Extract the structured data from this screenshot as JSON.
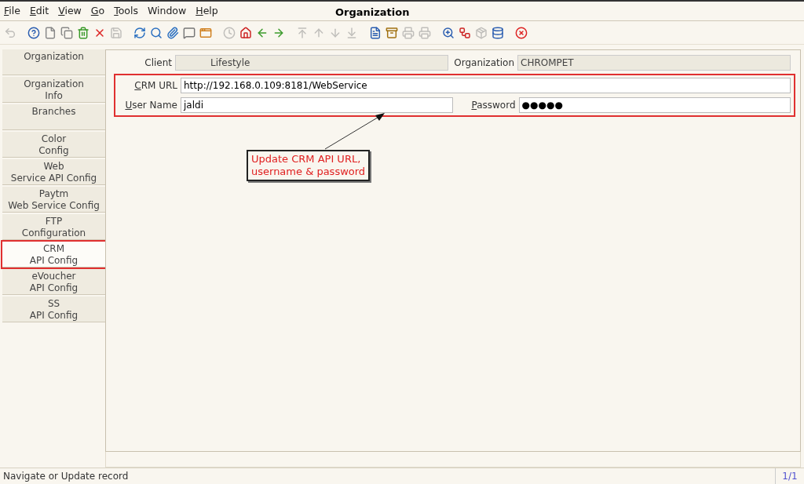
{
  "menu": [
    {
      "label": "File",
      "mnemonic": true
    },
    {
      "label": "Edit",
      "mnemonic": true
    },
    {
      "label": "View",
      "mnemonic": true
    },
    {
      "label": "Go",
      "mnemonic": true
    },
    {
      "label": "Tools",
      "mnemonic": true
    },
    {
      "label": "Window",
      "mnemonic": false
    },
    {
      "label": "Help",
      "mnemonic": true
    }
  ],
  "window": {
    "title": "Organization"
  },
  "toolbar": [
    [
      {
        "kind": "undo",
        "disabled": true
      }
    ],
    [
      {
        "kind": "help",
        "disabled": false
      },
      {
        "kind": "new",
        "disabled": false
      },
      {
        "kind": "copy",
        "disabled": false
      },
      {
        "kind": "delete",
        "disabled": false
      },
      {
        "kind": "delete-selection",
        "disabled": false
      },
      {
        "kind": "save",
        "disabled": true
      }
    ],
    [
      {
        "kind": "refresh",
        "disabled": false
      },
      {
        "kind": "find",
        "disabled": false
      },
      {
        "kind": "attach",
        "disabled": false
      },
      {
        "kind": "chat",
        "disabled": false
      },
      {
        "kind": "form",
        "disabled": false
      }
    ],
    [
      {
        "kind": "history",
        "disabled": true
      },
      {
        "kind": "home",
        "disabled": false
      },
      {
        "kind": "back",
        "disabled": false
      },
      {
        "kind": "forward",
        "disabled": false
      }
    ],
    [
      {
        "kind": "first",
        "disabled": true
      },
      {
        "kind": "previous",
        "disabled": true
      },
      {
        "kind": "next",
        "disabled": true
      },
      {
        "kind": "last",
        "disabled": true
      }
    ],
    [
      {
        "kind": "report",
        "disabled": false
      },
      {
        "kind": "archive",
        "disabled": false
      },
      {
        "kind": "print",
        "disabled": true
      },
      {
        "kind": "print-preview",
        "disabled": true
      }
    ],
    [
      {
        "kind": "zoom-across",
        "disabled": false
      },
      {
        "kind": "workflow",
        "disabled": false
      },
      {
        "kind": "product",
        "disabled": true
      },
      {
        "kind": "database",
        "disabled": false
      }
    ],
    [
      {
        "kind": "close",
        "disabled": false
      }
    ]
  ],
  "tabs": [
    {
      "label": "Organization",
      "selected": false,
      "highlighted": false
    },
    {
      "label": "Organization\nInfo",
      "selected": false,
      "highlighted": false
    },
    {
      "label": "Branches",
      "selected": false,
      "highlighted": false
    },
    {
      "label": "Color\nConfig",
      "selected": false,
      "highlighted": false
    },
    {
      "label": "Web\nService API Config",
      "selected": false,
      "highlighted": false
    },
    {
      "label": "Paytm\nWeb Service Config",
      "selected": false,
      "highlighted": false
    },
    {
      "label": "FTP\nConfiguration",
      "selected": false,
      "highlighted": false
    },
    {
      "label": "CRM\nAPI Config",
      "selected": true,
      "highlighted": true
    },
    {
      "label": "eVoucher\nAPI Config",
      "selected": false,
      "highlighted": false
    },
    {
      "label": "SS\nAPI Config",
      "selected": false,
      "highlighted": false
    }
  ],
  "header_fields": [
    {
      "label": "Client",
      "value": "Lifestyle",
      "mnemonic": false
    },
    {
      "label": "Organization",
      "value": "CHROMPET",
      "mnemonic": false
    }
  ],
  "crm_fields": {
    "highlighted": true,
    "url": {
      "label": "CRM URL",
      "value": "http://192.168.0.109:8181/WebService",
      "mnemonic": true
    },
    "user": {
      "label": "User Name",
      "value": "jaldi",
      "mnemonic": true
    },
    "password": {
      "label": "Password",
      "value": "●●●●●",
      "mnemonic": true
    }
  },
  "annotation": {
    "text": "Update CRM API URL,\nusername & password"
  },
  "status_bar": {
    "message": "Navigate or Update record",
    "record": "1/1"
  }
}
